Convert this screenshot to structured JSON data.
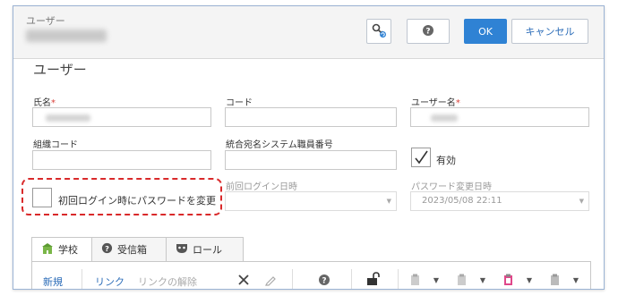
{
  "window": {
    "title": "ユーザー"
  },
  "toolbar": {
    "ok_label": "OK",
    "cancel_label": "キャンセル"
  },
  "page": {
    "title": "ユーザー"
  },
  "form": {
    "name": {
      "label": "氏名",
      "required_mark": "*"
    },
    "code": {
      "label": "コード"
    },
    "username": {
      "label": "ユーザー名",
      "required_mark": "*"
    },
    "org_code": {
      "label": "組織コード"
    },
    "staff_number": {
      "label": "統合宛名システム職員番号"
    },
    "enabled": {
      "label": "有効",
      "checked": true
    },
    "first_login_pw_change": {
      "label": "初回ログイン時にパスワードを変更",
      "checked": false
    },
    "last_login": {
      "label": "前回ログイン日時",
      "value": ""
    },
    "pw_changed": {
      "label": "パスワード変更日時",
      "value": "2023/05/08 22:11"
    }
  },
  "tabs": [
    {
      "label": "学校",
      "icon": "school-icon",
      "active": true
    },
    {
      "label": "受信箱",
      "icon": "help-icon",
      "active": false
    },
    {
      "label": "ロール",
      "icon": "role-icon",
      "active": false
    }
  ],
  "tab_toolbar": {
    "new_label": "新規",
    "link_label": "リンク",
    "unlink_label": "リンクの解除"
  },
  "colors": {
    "primary": "#2f82d4",
    "link": "#2b6cb8",
    "highlight_border": "#d9292a",
    "required": "#d9413a"
  }
}
